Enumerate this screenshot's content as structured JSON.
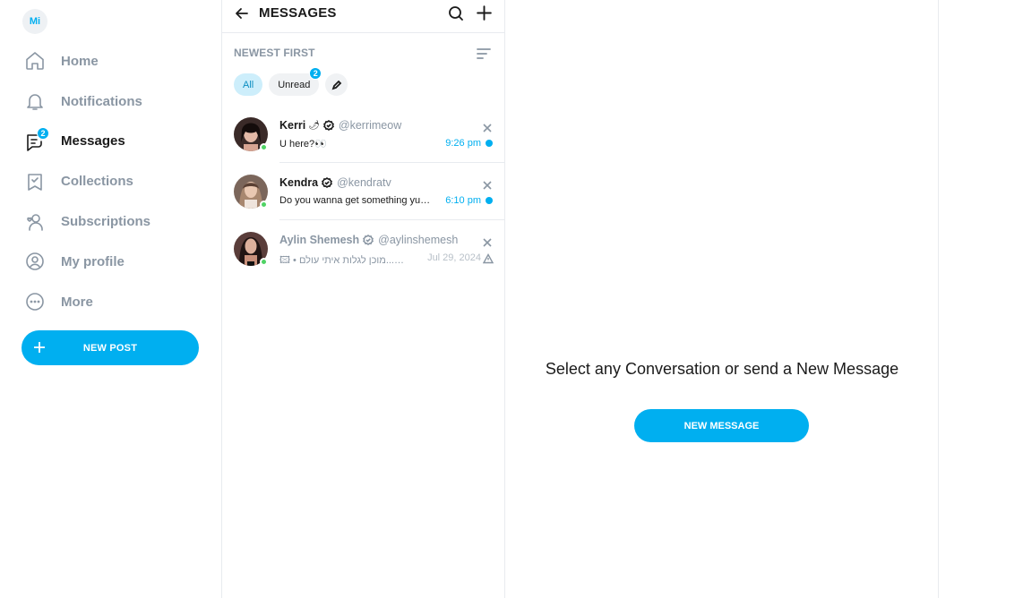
{
  "sidebar": {
    "avatar_initials": "Mi",
    "nav": [
      {
        "label": "Home",
        "icon": "home-icon"
      },
      {
        "label": "Notifications",
        "icon": "bell-icon"
      },
      {
        "label": "Messages",
        "icon": "message-icon",
        "badge": "2",
        "active": true
      },
      {
        "label": "Collections",
        "icon": "bookmark-icon"
      },
      {
        "label": "Subscriptions",
        "icon": "subscriptions-icon"
      },
      {
        "label": "My profile",
        "icon": "profile-icon"
      },
      {
        "label": "More",
        "icon": "more-icon"
      }
    ],
    "new_post_label": "NEW POST"
  },
  "messages": {
    "title": "MESSAGES",
    "sort_label": "NEWEST FIRST",
    "filters": {
      "all": "All",
      "unread": "Unread",
      "unread_badge": "2"
    },
    "conversations": [
      {
        "name": "Kerri",
        "emoji": "🌶",
        "handle": "@kerrimeow",
        "preview": "U here?👀",
        "time": "9:26 pm",
        "unread": true,
        "online": true
      },
      {
        "name": "Kendra",
        "handle": "@kendratv",
        "preview": "Do you wanna get something yum for me...",
        "time": "6:10 pm",
        "unread": true,
        "online": true
      },
      {
        "name": "Aylin Shemesh",
        "handle": "@aylinshemesh",
        "preview": "🖾 • מוכן לגלות איתי עולם...😏 Sheer",
        "time": "Jul 29, 2024",
        "unread": false,
        "online": true
      }
    ]
  },
  "pane": {
    "prompt": "Select any Conversation or send a New Message",
    "button_label": "NEW MESSAGE"
  },
  "colors": {
    "accent": "#00aff0",
    "muted": "#8a96a3",
    "online": "#4fd364"
  }
}
